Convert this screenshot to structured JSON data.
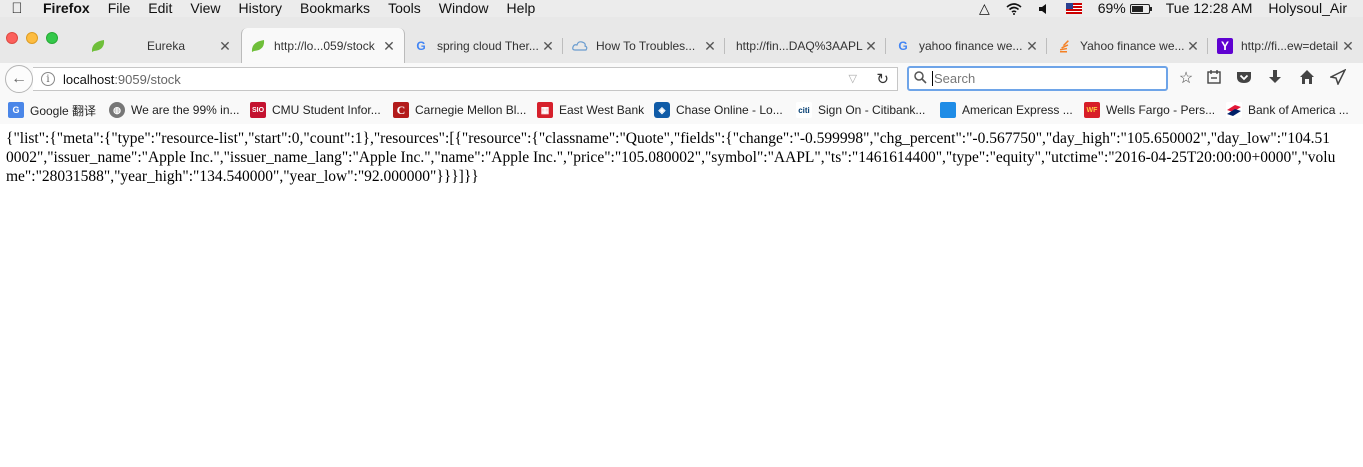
{
  "menubar": {
    "app_name": "Firefox",
    "menus": [
      "File",
      "Edit",
      "View",
      "History",
      "Bookmarks",
      "Tools",
      "Window",
      "Help"
    ],
    "battery": "69%",
    "battery_level": 0.69,
    "clock": "Tue 12:28 AM",
    "user": "Holysoul_Air"
  },
  "tabs": [
    {
      "label": "Eureka",
      "icon": "leaf-icon",
      "active": false
    },
    {
      "label": "http://lo...059/stock",
      "icon": "leaf-icon",
      "active": true
    },
    {
      "label": "spring cloud Ther...",
      "icon": "google-icon",
      "active": false
    },
    {
      "label": "How To Troubles...",
      "icon": "cloud-icon",
      "active": false
    },
    {
      "label": "http://fin...DAQ%3AAPL",
      "icon": "",
      "active": false
    },
    {
      "label": "yahoo finance we...",
      "icon": "google-icon",
      "active": false
    },
    {
      "label": "Yahoo finance we...",
      "icon": "stackoverflow-icon",
      "active": false
    },
    {
      "label": "http://fi...ew=detail",
      "icon": "yahoo-icon",
      "active": false
    }
  ],
  "colors": {
    "leaf": "#6fbf3a",
    "accent_search": "#6ea4e8",
    "yahoo": "#5f01d1"
  },
  "urlbar": {
    "host": "localhost",
    "path": ":9059/stock"
  },
  "search": {
    "placeholder": "Search"
  },
  "bookmarks": [
    {
      "label": "Google 翻译",
      "icon": "google-translate-icon",
      "color": "#4a86e8"
    },
    {
      "label": "We are the 99% in...",
      "icon": "globe-icon",
      "color": "#777777"
    },
    {
      "label": "CMU Student Infor...",
      "icon": "sio-icon",
      "color": "#c41230"
    },
    {
      "label": "Carnegie Mellon Bl...",
      "icon": "cmu-icon",
      "color": "#b31b1b"
    },
    {
      "label": "East West Bank",
      "icon": "eastwest-icon",
      "color": "#d6202c"
    },
    {
      "label": "Chase Online - Lo...",
      "icon": "chase-icon",
      "color": "#0f5ba7"
    },
    {
      "label": "Sign On - Citibank...",
      "icon": "citi-icon",
      "color": "#003b70"
    },
    {
      "label": "American Express ...",
      "icon": "amex-icon",
      "color": "#1f8ce6"
    },
    {
      "label": "Wells Fargo - Pers...",
      "icon": "wellsfargo-icon",
      "color": "#d71e28"
    },
    {
      "label": "Bank of America ...",
      "icon": "boa-icon",
      "color": "#e31837"
    }
  ],
  "content": {
    "json": "{\"list\":{\"meta\":{\"type\":\"resource-list\",\"start\":0,\"count\":1},\"resources\":[{\"resource\":{\"classname\":\"Quote\",\"fields\":{\"change\":\"-0.599998\",\"chg_percent\":\"-0.567750\",\"day_high\":\"105.650002\",\"day_low\":\"104.510002\",\"issuer_name\":\"Apple Inc.\",\"issuer_name_lang\":\"Apple Inc.\",\"name\":\"Apple Inc.\",\"price\":\"105.080002\",\"symbol\":\"AAPL\",\"ts\":\"1461614400\",\"type\":\"equity\",\"utctime\":\"2016-04-25T20:00:00+0000\",\"volume\":\"28031588\",\"year_high\":\"134.540000\",\"year_low\":\"92.000000\"}}}]}}"
  }
}
